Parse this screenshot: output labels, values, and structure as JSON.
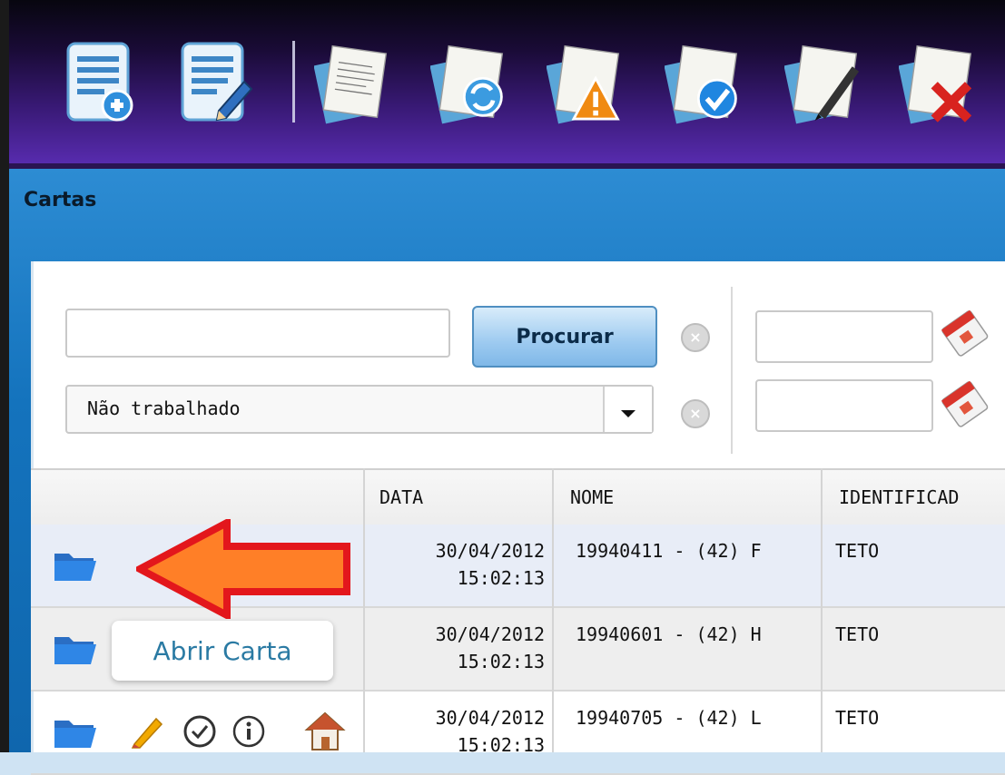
{
  "toolbar": {
    "buttons": [
      {
        "name": "new-document-icon"
      },
      {
        "name": "edit-document-icon"
      },
      {
        "name": "letter-document-icon"
      },
      {
        "name": "refresh-letter-icon"
      },
      {
        "name": "warning-letter-icon"
      },
      {
        "name": "approve-letter-icon"
      },
      {
        "name": "sign-letter-icon"
      },
      {
        "name": "delete-letter-icon"
      }
    ]
  },
  "panel": {
    "title": "Cartas"
  },
  "search": {
    "value": "",
    "button_label": "Procurar"
  },
  "filter": {
    "selected": "Não trabalhado"
  },
  "dates": {
    "start": "",
    "end": ""
  },
  "table": {
    "headers": [
      "",
      "DATA",
      "NOME",
      "IDENTIFICAD"
    ],
    "rows": [
      {
        "date": "30/04/2012",
        "time": "15:02:13",
        "nome": "19940411 - (42) F",
        "ident": "TETO"
      },
      {
        "date": "30/04/2012",
        "time": "15:02:13",
        "nome": "19940601 - (42) H",
        "ident": "TETO"
      },
      {
        "date": "30/04/2012",
        "time": "15:02:13",
        "nome": "19940705 - (42) L",
        "ident": "TETO"
      }
    ]
  },
  "tooltip": {
    "text": "Abrir Carta"
  },
  "colors": {
    "toolbar": "#3a1a78",
    "panel": "#1473bd",
    "tooltip_text": "#2a7aa3",
    "arrow_fill": "#ff7f27",
    "arrow_stroke": "#e3171c"
  }
}
